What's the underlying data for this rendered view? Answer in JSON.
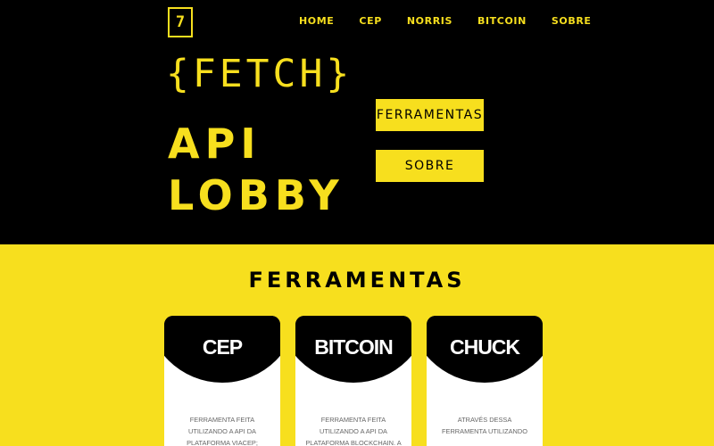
{
  "logo": {
    "glyph": "7"
  },
  "nav": {
    "items": [
      {
        "label": "HOME"
      },
      {
        "label": "CEP"
      },
      {
        "label": "NORRIS"
      },
      {
        "label": "BITCOIN"
      },
      {
        "label": "SOBRE"
      }
    ]
  },
  "hero": {
    "line1": "{FETCH}",
    "line2": "API",
    "line3": "LOBBY",
    "buttons": {
      "tools": "FERRAMENTAS",
      "about": "SOBRE"
    }
  },
  "tools_section": {
    "title": "FERRAMENTAS",
    "cards": [
      {
        "title": "CEP",
        "text": "Ferramenta feita utilizando a API da plataforma ViaCEP; através dela é"
      },
      {
        "title": "BITCOIN",
        "text": "Ferramenta feita utilizando a API da plataforma Blockchain. A partir dessa"
      },
      {
        "title": "CHUCK",
        "text": "Através dessa ferramenta utilizando"
      }
    ]
  },
  "colors": {
    "accent": "#f7df1e",
    "dark": "#000000",
    "card": "#ffffff"
  }
}
